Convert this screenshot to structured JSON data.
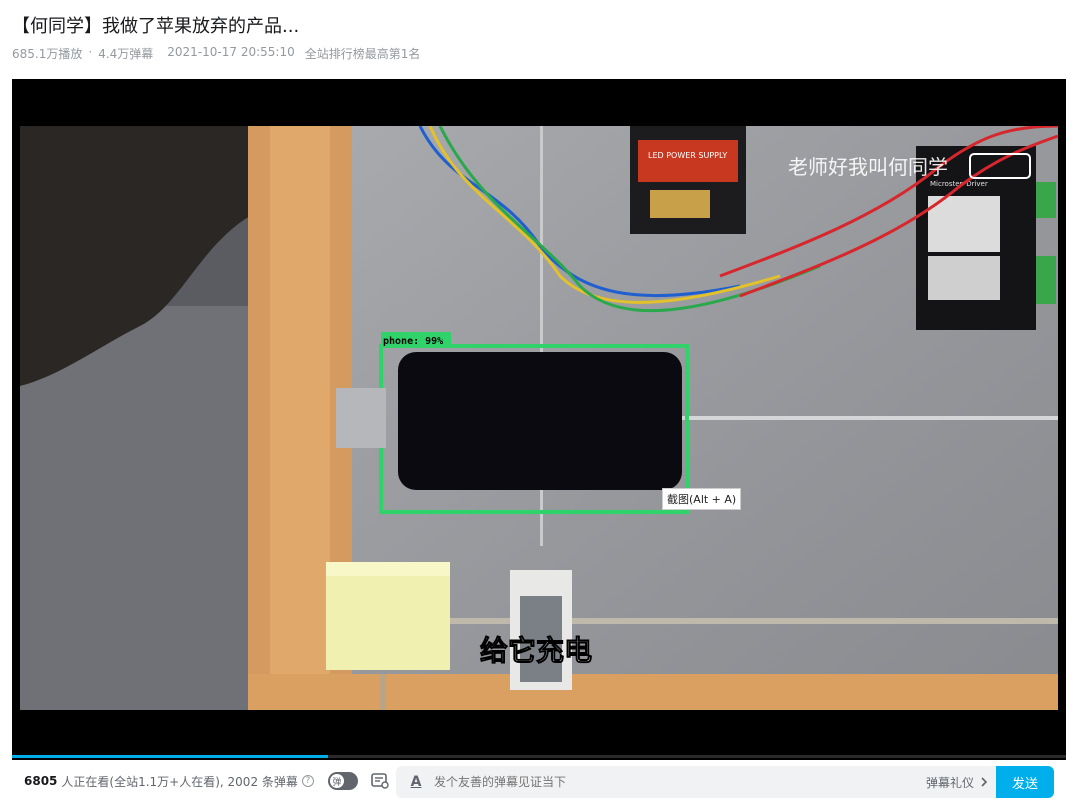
{
  "video": {
    "title": "【何同学】我做了苹果放弃的产品...",
    "views": "685.1万播放",
    "danmaku_count": "4.4万弹幕",
    "publish_time": "2021-10-17 20:55:10",
    "rank": "全站排行榜最高第1名"
  },
  "frame": {
    "detection_label": "phone: 99%",
    "subtitle": "给它充电",
    "watermark": "老师好我叫何同学",
    "power_supply_label": "LED POWER SUPPLY",
    "driver_label": "Microstep Driver"
  },
  "tooltip": {
    "screenshot": "截图(Alt + A)"
  },
  "progress": {
    "fraction": 0.3
  },
  "bottom_bar": {
    "viewers_count": "6805",
    "viewers_text": "人正在看(全站1.1万+人在看), 2002 条弹幕",
    "help_symbol": "?",
    "toggle_label": "弹",
    "font_icon": "A",
    "input_placeholder": "发个友善的弹幕见证当下",
    "etiquette": "弹幕礼仪",
    "send": "发送"
  },
  "colors": {
    "accent": "#00aeec",
    "detection_box": "#2fd36a"
  }
}
